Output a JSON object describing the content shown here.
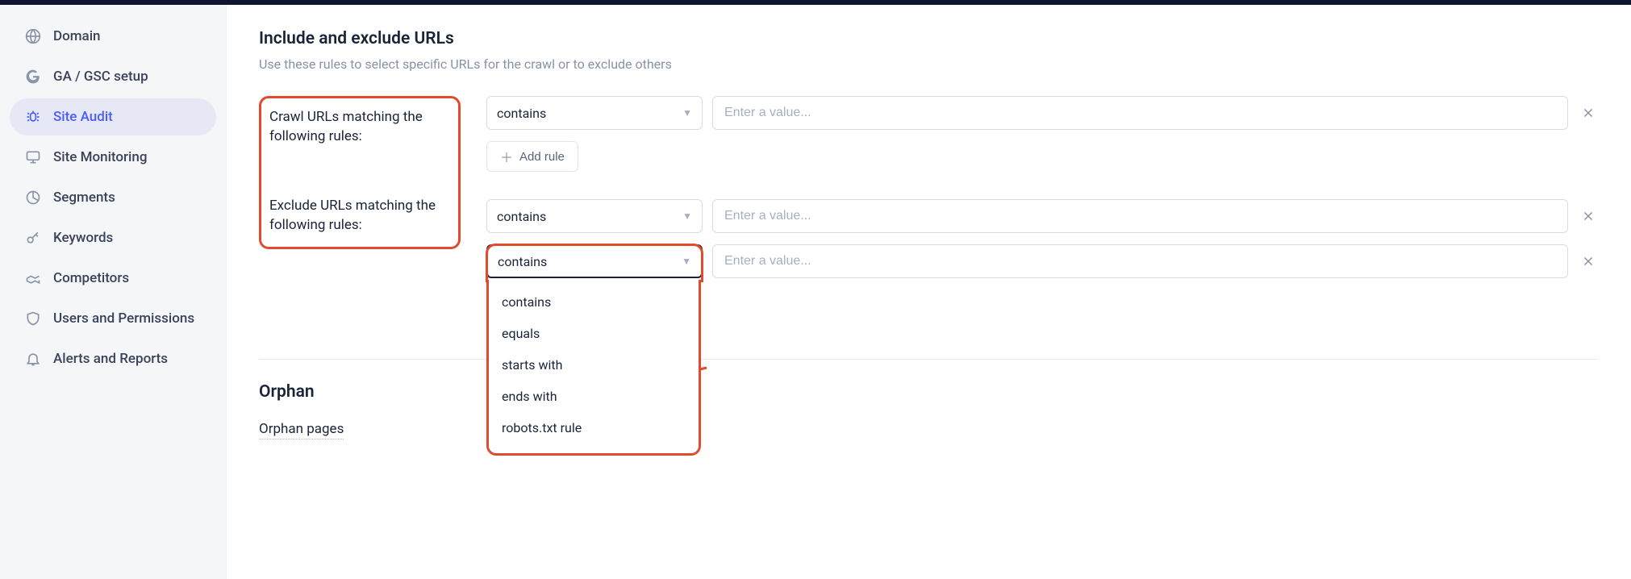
{
  "sidebar": {
    "items": [
      {
        "label": "Domain"
      },
      {
        "label": "GA / GSC setup"
      },
      {
        "label": "Site Audit"
      },
      {
        "label": "Site Monitoring"
      },
      {
        "label": "Segments"
      },
      {
        "label": "Keywords"
      },
      {
        "label": "Competitors"
      },
      {
        "label": "Users and Permissions"
      },
      {
        "label": "Alerts and Reports"
      }
    ]
  },
  "section": {
    "title": "Include and exclude URLs",
    "desc": "Use these rules to select specific URLs for the crawl or to exclude others"
  },
  "rules": {
    "crawl_label": "Crawl URLs matching the following rules:",
    "exclude_label": "Exclude URLs matching the following rules:",
    "add_rule": "Add rule",
    "value_placeholder": "Enter a value...",
    "crawl_rows": [
      {
        "op": "contains"
      }
    ],
    "exclude_rows": [
      {
        "op": "contains"
      },
      {
        "op": "contains",
        "open": true
      }
    ],
    "operators": [
      "contains",
      "equals",
      "starts with",
      "ends with",
      "robots.txt rule"
    ]
  },
  "orphan": {
    "title": "Orphan",
    "sub": "Orphan pages"
  }
}
